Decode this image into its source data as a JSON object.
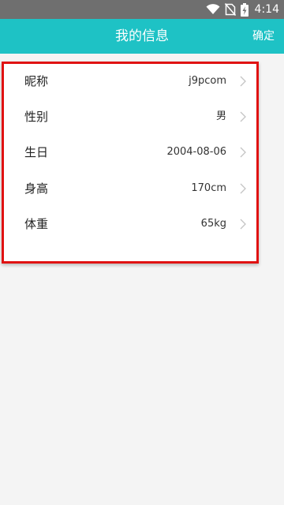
{
  "status_bar": {
    "time": "4:14",
    "icons": [
      "wifi-icon",
      "no-sim-icon",
      "battery-charging-icon"
    ]
  },
  "header": {
    "title": "我的信息",
    "confirm_label": "确定"
  },
  "profile": {
    "rows": [
      {
        "label": "昵称",
        "value": "j9pcom"
      },
      {
        "label": "性别",
        "value": "男"
      },
      {
        "label": "生日",
        "value": "2004-08-06"
      },
      {
        "label": "身高",
        "value": "170cm"
      },
      {
        "label": "体重",
        "value": "65kg"
      }
    ]
  },
  "colors": {
    "accent": "#1ec2c5",
    "status_bar": "#6f6f6f",
    "highlight_border": "#e01212",
    "background": "#f4f4f4"
  }
}
